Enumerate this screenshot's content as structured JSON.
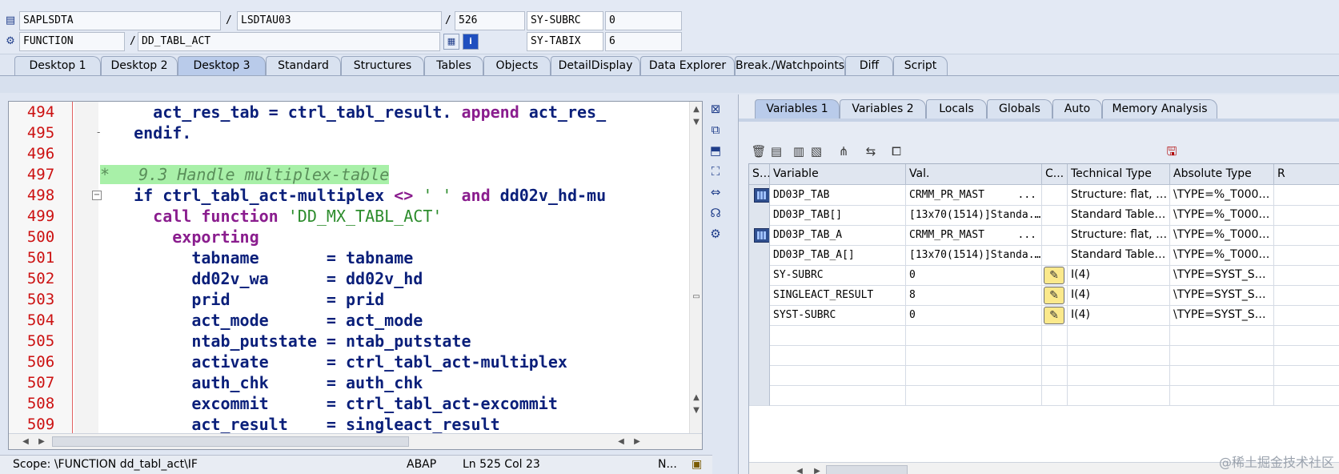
{
  "header": {
    "row1": {
      "program": "SAPLSDTA",
      "include": "LSDTAU03",
      "line": "526",
      "var_label": "SY-SUBRC",
      "var_value": "0"
    },
    "row2": {
      "type": "FUNCTION",
      "name": "DD_TABL_ACT",
      "var_label": "SY-TABIX",
      "var_value": "6"
    },
    "slash": "/"
  },
  "tabs": [
    "Desktop 1",
    "Desktop 2",
    "Desktop 3",
    "Standard",
    "Structures",
    "Tables",
    "Objects",
    "DetailDisplay",
    "Data Explorer",
    "Break./Watchpoints",
    "Diff",
    "Script"
  ],
  "active_tab": "Desktop 3",
  "editor": {
    "lines": [
      {
        "n": "494",
        "parts": [
          [
            "",
            "    act_res_tab = ctrl_tabl_result. "
          ],
          [
            "kw",
            "append"
          ],
          [
            "",
            " act_res_"
          ]
        ]
      },
      {
        "n": "495",
        "parts": [
          [
            "",
            "  endif."
          ]
        ]
      },
      {
        "n": "496",
        "parts": []
      },
      {
        "n": "497",
        "comment": "*   9.3 Handle multiplex-table"
      },
      {
        "n": "498",
        "parts": [
          [
            "",
            "  if ctrl_tabl_act-multiplex "
          ],
          [
            "kw",
            "<>"
          ],
          [
            "str",
            " ' ' "
          ],
          [
            "kw",
            "and"
          ],
          [
            "",
            " dd02v_hd-mu"
          ]
        ]
      },
      {
        "n": "499",
        "parts": [
          [
            "",
            "    "
          ],
          [
            "kw",
            "call function"
          ],
          [
            "str",
            " 'DD_MX_TABL_ACT'"
          ]
        ]
      },
      {
        "n": "500",
        "parts": [
          [
            "kw",
            "      exporting"
          ]
        ]
      },
      {
        "n": "501",
        "parts": [
          [
            "",
            "        tabname       = tabname"
          ]
        ]
      },
      {
        "n": "502",
        "parts": [
          [
            "",
            "        dd02v_wa      = dd02v_hd"
          ]
        ]
      },
      {
        "n": "503",
        "parts": [
          [
            "",
            "        prid          = prid"
          ]
        ]
      },
      {
        "n": "504",
        "parts": [
          [
            "",
            "        act_mode      = act_mode"
          ]
        ]
      },
      {
        "n": "505",
        "parts": [
          [
            "",
            "        ntab_putstate = ntab_putstate"
          ]
        ]
      },
      {
        "n": "506",
        "parts": [
          [
            "",
            "        activate      = ctrl_tabl_act-multiplex"
          ]
        ]
      },
      {
        "n": "507",
        "parts": [
          [
            "",
            "        auth_chk      = auth_chk"
          ]
        ]
      },
      {
        "n": "508",
        "parts": [
          [
            "",
            "        excommit      = ctrl_tabl_act-excommit"
          ]
        ]
      },
      {
        "n": "509",
        "parts": [
          [
            "",
            "        act_result    = singleact_result"
          ]
        ]
      }
    ]
  },
  "status": {
    "scope": "Scope: \\FUNCTION dd_tabl_act\\IF",
    "lang": "ABAP",
    "position": "Ln 525 Col  23",
    "mode": "N..."
  },
  "right": {
    "tabs": [
      "Variables 1",
      "Variables 2",
      "Locals",
      "Globals",
      "Auto",
      "Memory Analysis"
    ],
    "active_tab": "Variables 1",
    "columns": [
      "S...",
      "Variable",
      "Val.",
      "C...",
      "Technical Type",
      "Absolute Type",
      "R"
    ],
    "rows": [
      {
        "icon": true,
        "variable": "DD03P_TAB",
        "value": "CRMM_PR_MAST",
        "value_more": "...",
        "change": false,
        "tech": "Structure: flat, ch...",
        "abs": "\\TYPE=%_T0000..."
      },
      {
        "icon": false,
        "variable": "DD03P_TAB[]",
        "value": "[13x70(1514)]Standa...",
        "value_more": "",
        "change": false,
        "tech": "Standard Table[13...",
        "abs": "\\TYPE=%_T0000..."
      },
      {
        "icon": true,
        "variable": "DD03P_TAB_A",
        "value": "CRMM_PR_MAST",
        "value_more": "...",
        "change": false,
        "tech": "Structure: flat, ch...",
        "abs": "\\TYPE=%_T0000..."
      },
      {
        "icon": false,
        "variable": "DD03P_TAB_A[]",
        "value": "[13x70(1514)]Standa...",
        "value_more": "",
        "change": false,
        "tech": "Standard Table[13...",
        "abs": "\\TYPE=%_T0000..."
      },
      {
        "icon": false,
        "variable": "SY-SUBRC",
        "value": "0",
        "value_more": "",
        "change": true,
        "tech": "I(4)",
        "abs": "\\TYPE=SYST_SUB..."
      },
      {
        "icon": false,
        "variable": "SINGLEACT_RESULT",
        "value": "8",
        "value_more": "",
        "change": true,
        "tech": "I(4)",
        "abs": "\\TYPE=SYST_SUB..."
      },
      {
        "icon": false,
        "variable": "SYST-SUBRC",
        "value": "0",
        "value_more": "",
        "change": true,
        "tech": "I(4)",
        "abs": "\\TYPE=SYST_SUB..."
      }
    ],
    "empty_rows": 4,
    "editor_icons": [
      "trash-icon",
      "details-icon",
      "details2-icon",
      "export-icon",
      "tree-icon",
      "flow-icon",
      "window-icon"
    ],
    "save_icon": "save-icon"
  },
  "watermark": "@稀土掘金技术社区"
}
